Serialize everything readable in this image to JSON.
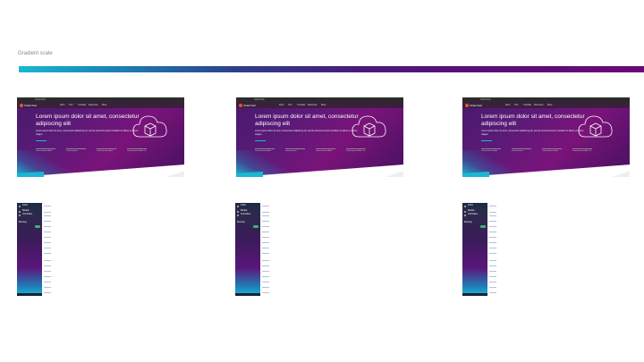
{
  "page": {
    "title": "Gradient scale"
  },
  "gradient_bar": {
    "colors": [
      "#1ab7d3",
      "#1a8cbe",
      "#2f3e8c",
      "#4a1a7a",
      "#5b0e78",
      "#6a0a74"
    ]
  },
  "hero_cards": [
    {
      "brand": "Charmhub",
      "heading": "Lorem ipsum dolor sit amet, consectetur adipiscing elit",
      "body": "Lorem ipsum dolor sit amet, consectetur adipiscing elit, sed do eiusmod tempor incididunt ut labore et dolore magna",
      "nav_items": [
        "Docs",
        "Tour",
        "Tutorials",
        "Discourse",
        "More"
      ],
      "links": [
        "Lorem ipsum dolor",
        "Lorem ipsum",
        "Lorem ipsum dolor",
        "Lorem ipsum dolor sit"
      ],
      "cloud_icon": "cloud-box-icon"
    },
    {
      "brand": "Charmhub",
      "heading": "Lorem ipsum dolor sit amet, consectetur adipiscing elit",
      "body": "Lorem ipsum dolor sit amet, consectetur adipiscing elit, sed do eiusmod tempor incididunt ut labore et dolore magna",
      "nav_items": [
        "Docs",
        "Tour",
        "Tutorials",
        "Discourse",
        "More"
      ],
      "links": [
        "Lorem ipsum dolor",
        "Lorem ipsum",
        "Lorem ipsum dolor",
        "Lorem ipsum dolor sit"
      ],
      "cloud_icon": "cloud-box-icon"
    },
    {
      "brand": "Charmhub",
      "heading": "Lorem ipsum dolor sit amet, consectetur adipiscing elit",
      "body": "Lorem ipsum dolor sit amet, consectetur adipiscing elit, sed do eiusmod tempor incididunt ut labore et dolore magna",
      "nav_items": [
        "Docs",
        "Tour",
        "Tutorials",
        "Discourse",
        "More"
      ],
      "links": [
        "Lorem ipsum dolor",
        "Lorem ipsum",
        "Lorem ipsum dolor",
        "Lorem ipsum dolor sit"
      ],
      "cloud_icon": "cloud-box-icon"
    }
  ],
  "side_panels": [
    {
      "app": "JAAS",
      "items": [
        "Models",
        "Controllers"
      ],
      "status": "Running"
    },
    {
      "app": "JAAS",
      "items": [
        "Models",
        "Controllers"
      ],
      "status": "Running"
    },
    {
      "app": "JAAS",
      "items": [
        "Models",
        "Controllers"
      ],
      "status": "Running"
    }
  ]
}
